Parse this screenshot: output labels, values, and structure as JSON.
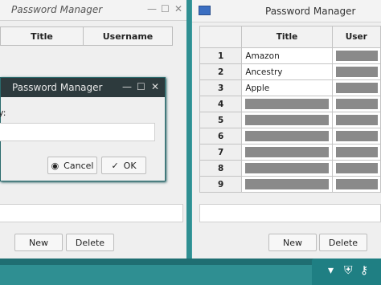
{
  "left_window": {
    "title": "Password Manager",
    "columns": [
      "Title",
      "Username"
    ],
    "new_label": "New",
    "delete_label": "Delete"
  },
  "dialog": {
    "title": "Password Manager",
    "prompt_fragment": "y:",
    "cancel_label": "Cancel",
    "ok_label": "OK"
  },
  "right_window": {
    "title": "Password Manager",
    "columns": [
      "",
      "Title",
      "User"
    ],
    "rows": [
      {
        "num": "1",
        "title": "Amazon"
      },
      {
        "num": "2",
        "title": "Ancestry"
      },
      {
        "num": "3",
        "title": "Apple"
      },
      {
        "num": "4",
        "title": ""
      },
      {
        "num": "5",
        "title": ""
      },
      {
        "num": "6",
        "title": ""
      },
      {
        "num": "7",
        "title": ""
      },
      {
        "num": "8",
        "title": ""
      },
      {
        "num": "9",
        "title": ""
      }
    ],
    "new_label": "New",
    "delete_label": "Delete"
  },
  "tray": {
    "icons": [
      "wifi-icon",
      "shield-check-icon",
      "key-icon"
    ]
  }
}
